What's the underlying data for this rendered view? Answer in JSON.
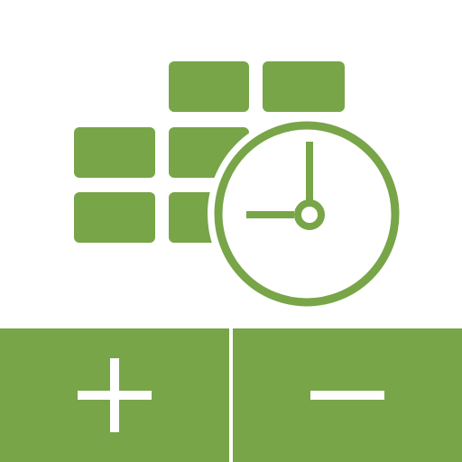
{
  "app": {
    "icons": {
      "logo": "calendar-clock-icon",
      "increment": "plus-icon",
      "decrement": "minus-icon"
    },
    "colors": {
      "accent": "#78a548",
      "background": "#ffffff",
      "glyph": "#ffffff"
    }
  }
}
